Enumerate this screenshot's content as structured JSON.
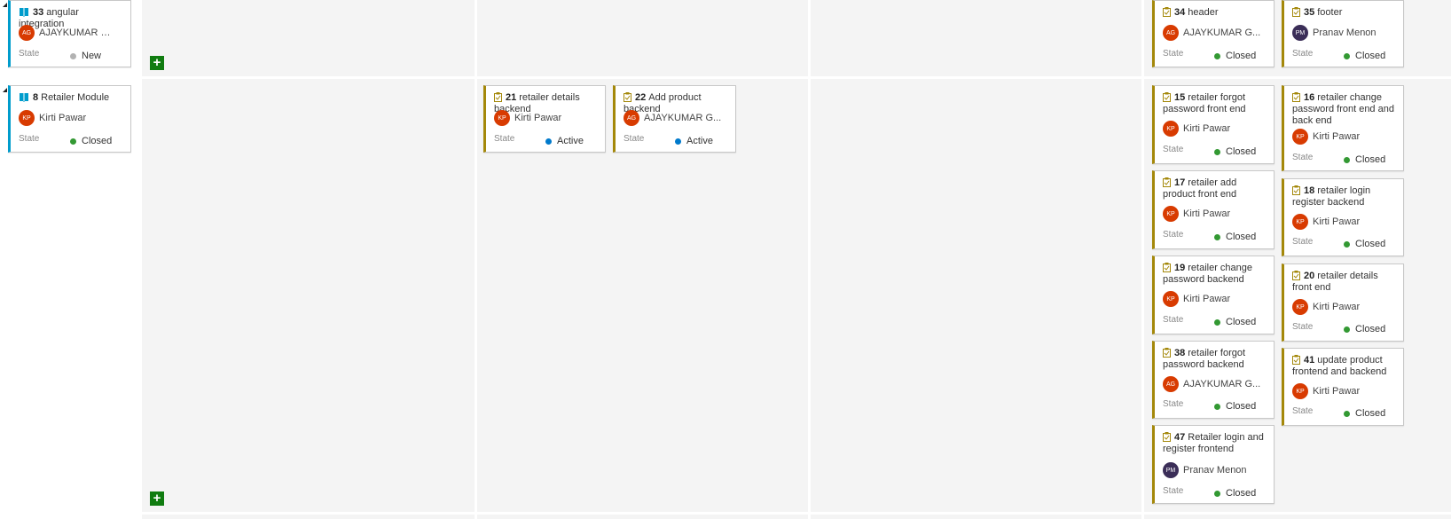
{
  "colors": {
    "story_accent": "#009ccc",
    "task_accent": "#a4880a",
    "state_closed": "#339933",
    "state_active": "#007acc",
    "state_new": "#b2b2b2",
    "add_button": "#107c10"
  },
  "common": {
    "state_label": "State",
    "add_icon": "+"
  },
  "rows": [
    {
      "parent": {
        "id": "33",
        "title": "angular integration",
        "icon": "story-book-icon",
        "initials": "AG",
        "assignee": "AJAYKUMAR GAN...",
        "state": "New"
      },
      "done": [
        {
          "id": "34",
          "title": "header",
          "initials": "AG",
          "assignee": "AJAYKUMAR G...",
          "state": "Closed"
        },
        {
          "id": "35",
          "title": "footer",
          "initials": "PM",
          "assignee": "Pranav Menon",
          "state": "Closed"
        }
      ]
    },
    {
      "parent": {
        "id": "8",
        "title": "Retailer Module",
        "icon": "story-book-icon",
        "initials": "KP",
        "assignee": "Kirti Pawar",
        "state": "Closed"
      },
      "in_progress": [
        {
          "id": "21",
          "title": "retailer details backend",
          "initials": "KP",
          "assignee": "Kirti Pawar",
          "state": "Active"
        },
        {
          "id": "22",
          "title": "Add product backend",
          "initials": "AG",
          "assignee": "AJAYKUMAR G...",
          "state": "Active"
        }
      ],
      "done": [
        {
          "id": "15",
          "title": "retailer  forgot password front end",
          "initials": "KP",
          "assignee": "Kirti Pawar",
          "state": "Closed"
        },
        {
          "id": "16",
          "title": "retailer change password front end and back end",
          "initials": "KP",
          "assignee": "Kirti Pawar",
          "state": "Closed"
        },
        {
          "id": "17",
          "title": "retailer add product front end",
          "initials": "KP",
          "assignee": "Kirti Pawar",
          "state": "Closed"
        },
        {
          "id": "18",
          "title": "retailer login register backend",
          "initials": "KP",
          "assignee": "Kirti Pawar",
          "state": "Closed"
        },
        {
          "id": "19",
          "title": "retailer change password backend",
          "initials": "KP",
          "assignee": "Kirti Pawar",
          "state": "Closed"
        },
        {
          "id": "20",
          "title": "retailer details  front end",
          "initials": "KP",
          "assignee": "Kirti Pawar",
          "state": "Closed"
        },
        {
          "id": "38",
          "title": "retailer forgot password backend",
          "initials": "AG",
          "assignee": "AJAYKUMAR G...",
          "state": "Closed"
        },
        {
          "id": "41",
          "title": "update product frontend and backend",
          "initials": "KP",
          "assignee": "Kirti Pawar",
          "state": "Closed"
        },
        {
          "id": "47",
          "title": "Retailer login and register frontend",
          "initials": "PM",
          "assignee": "Pranav Menon",
          "state": "Closed"
        }
      ]
    }
  ]
}
